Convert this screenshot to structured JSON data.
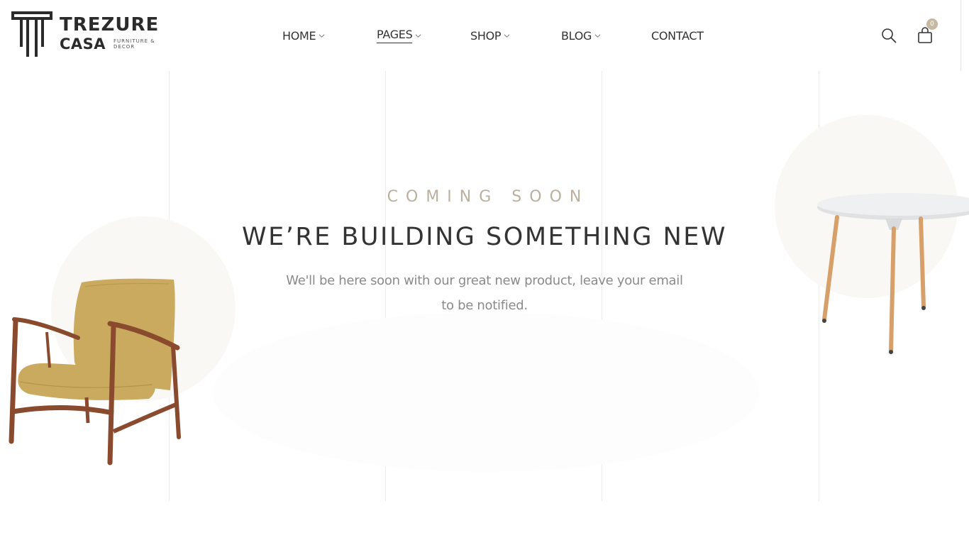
{
  "brand": {
    "name_line1": "TREZURE",
    "name_line2": "CASA",
    "tagline": "FURNITURE & DECOR"
  },
  "nav": {
    "items": [
      {
        "label": "HOME",
        "has_dropdown": true
      },
      {
        "label": "PAGES",
        "has_dropdown": true,
        "active": true
      },
      {
        "label": "SHOP",
        "has_dropdown": true
      },
      {
        "label": "BLOG",
        "has_dropdown": true
      },
      {
        "label": "CONTACT",
        "has_dropdown": false
      }
    ]
  },
  "header_actions": {
    "search_icon": "search-icon",
    "cart_icon": "shopping-bag-icon",
    "cart_count": "0"
  },
  "hero": {
    "kicker": "COMING SOON",
    "headline": "WE’RE BUILDING SOMETHING NEW",
    "description": "We'll be here soon with our great new product, leave your email to be notified."
  },
  "colors": {
    "accent": "#c5b9a3",
    "kicker": "#b9b0a0",
    "text_dark": "#333333",
    "text_muted": "#8a8a8a",
    "chair_seat": "#c9aa5f",
    "chair_wood": "#8a4a2e"
  }
}
